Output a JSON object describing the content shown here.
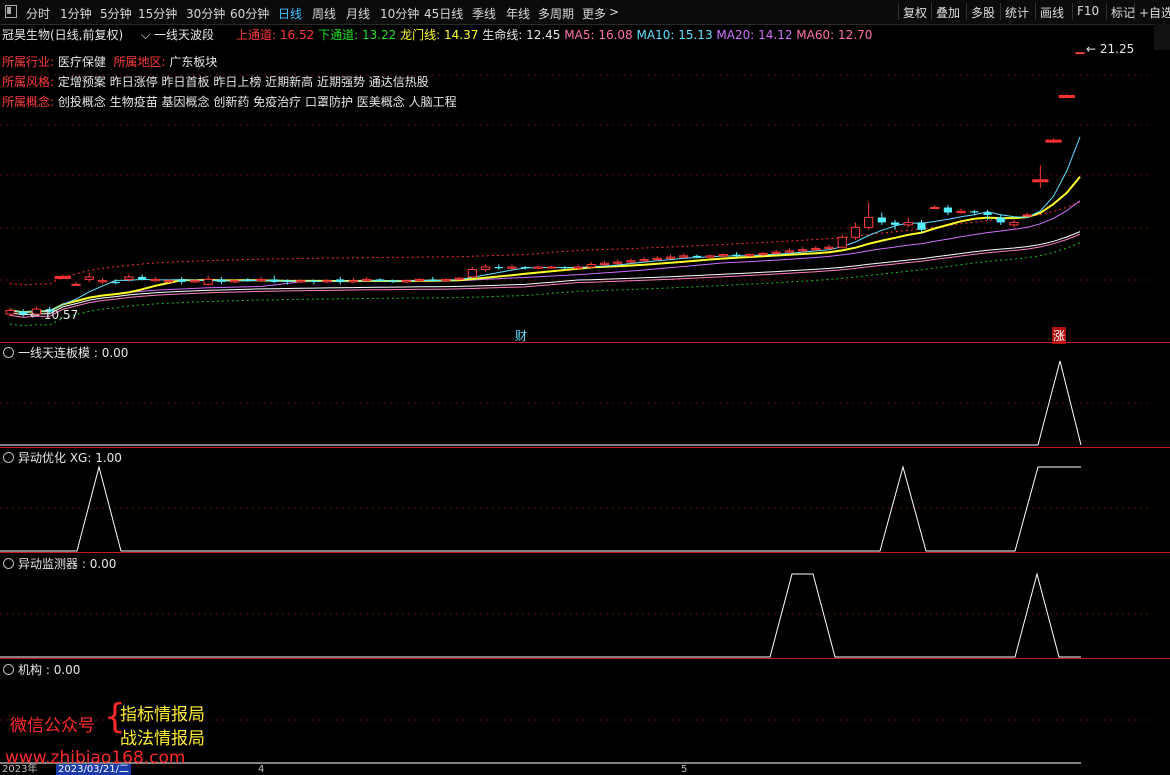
{
  "toolbar": {
    "periods": [
      "分时",
      "1分钟",
      "5分钟",
      "15分钟",
      "30分钟",
      "60分钟",
      "日线",
      "周线",
      "月线",
      "10分钟",
      "45日线",
      "季线",
      "年线",
      "多周期",
      "更多"
    ],
    "active_period": "日线",
    "right_buttons": [
      "复权",
      "叠加",
      "多股",
      "统计",
      "画线",
      "F10",
      "标记",
      "+自选"
    ]
  },
  "header": {
    "stock_title": "冠昊生物(日线,前复权)",
    "indicator_name": "一线天波段",
    "upper_label": "上通道:",
    "upper_value": "16.52",
    "lower_label": "下通道:",
    "lower_value": "13.22",
    "dragon_label": "龙门线:",
    "dragon_value": "14.37",
    "life_label": "生命线:",
    "life_value": "12.45",
    "ma5_label": "MA5:",
    "ma5_value": "16.08",
    "ma10_label": "MA10:",
    "ma10_value": "15.13",
    "ma20_label": "MA20:",
    "ma20_value": "14.12",
    "ma60_label": "MA60:",
    "ma60_value": "12.70"
  },
  "info": {
    "industry_label": "所属行业:",
    "industry_value": "医疗保健",
    "region_label": "所属地区:",
    "region_value": "广东板块",
    "style_label": "所属风格:",
    "style_value": "定增预案 昨日涨停 昨日首板 昨日上榜 近期新高 近期强势 通达信热股",
    "concept_label": "所属概念:",
    "concept_value": "创投概念 生物疫苗 基因概念 创新药 免疫治疗 口罩防护 医美概念 人脑工程"
  },
  "price_labels": {
    "high": "21.25",
    "low": "10.57",
    "marker_cai": "财",
    "marker_zhang": "涨"
  },
  "panels": [
    {
      "name": "一线天连板模",
      "value_text": " : 0.00"
    },
    {
      "name": "异动优化",
      "value_text": " XG: 1.00"
    },
    {
      "name": "异动监测器",
      "value_text": " : 0.00"
    },
    {
      "name": "机构",
      "value_text": " : 0.00"
    }
  ],
  "watermark": {
    "wechat": "微信公众号",
    "line1": "指标情报局",
    "line2": "战法情报局",
    "url": "www.zhibiao168.com"
  },
  "date_axis": {
    "year": "2023年",
    "cursor_date": "2023/03/21/二",
    "month_4": "4",
    "month_5": "5"
  },
  "colors": {
    "up": "#ff3b3b",
    "down": "#54f0ff",
    "limit_up": "#ffee00",
    "ma5": "#ffffff",
    "ma10": "#ffff2a",
    "ma20": "#d070ff",
    "ma60": "#22e022"
  },
  "chart_data": {
    "type": "candlestick",
    "price_axis_range": [
      10.3,
      21.6
    ],
    "candles": [
      [
        10.7,
        10.85,
        10.95,
        10.6
      ],
      [
        10.8,
        10.7,
        10.9,
        10.6
      ],
      [
        10.7,
        10.9,
        11.0,
        10.65
      ],
      [
        10.9,
        10.8,
        11.0,
        10.7
      ],
      [
        12.2,
        12.2,
        12.3,
        12.15
      ],
      [
        11.9,
        11.9,
        12.0,
        11.85
      ],
      [
        12.1,
        12.2,
        12.35,
        12.0
      ],
      [
        12.0,
        12.05,
        12.15,
        11.9
      ],
      [
        12.0,
        11.95,
        12.1,
        11.9
      ],
      [
        12.1,
        12.2,
        12.3,
        12.0
      ],
      [
        12.2,
        12.1,
        12.3,
        12.05
      ],
      [
        12.05,
        12.1,
        12.2,
        12.0
      ],
      [
        12.0,
        12.05,
        12.1,
        11.95
      ],
      [
        12.1,
        12.0,
        12.2,
        11.9
      ],
      [
        12.0,
        12.05,
        12.1,
        11.95
      ],
      [
        11.9,
        12.1,
        12.25,
        11.85
      ],
      [
        12.1,
        12.0,
        12.2,
        11.9
      ],
      [
        12.0,
        12.05,
        12.1,
        11.95
      ],
      [
        12.1,
        12.05,
        12.15,
        12.0
      ],
      [
        12.05,
        12.1,
        12.2,
        12.0
      ],
      [
        12.1,
        12.0,
        12.25,
        11.95
      ],
      [
        12.05,
        12.0,
        12.1,
        11.9
      ],
      [
        12.0,
        12.05,
        12.1,
        11.95
      ],
      [
        12.05,
        12.0,
        12.1,
        11.9
      ],
      [
        12.0,
        12.05,
        12.1,
        11.95
      ],
      [
        12.1,
        12.0,
        12.2,
        11.9
      ],
      [
        12.0,
        12.05,
        12.15,
        11.95
      ],
      [
        12.05,
        12.1,
        12.2,
        12.0
      ],
      [
        12.1,
        12.05,
        12.15,
        12.0
      ],
      [
        12.05,
        12.0,
        12.1,
        11.95
      ],
      [
        12.0,
        12.05,
        12.1,
        11.95
      ],
      [
        12.05,
        12.1,
        12.15,
        12.0
      ],
      [
        12.1,
        12.05,
        12.2,
        12.0
      ],
      [
        12.05,
        12.1,
        12.15,
        12.0
      ],
      [
        12.1,
        12.15,
        12.2,
        12.05
      ],
      [
        12.2,
        12.5,
        12.6,
        12.15
      ],
      [
        12.5,
        12.6,
        12.7,
        12.4
      ],
      [
        12.6,
        12.55,
        12.7,
        12.5
      ],
      [
        12.55,
        12.6,
        12.7,
        12.5
      ],
      [
        12.6,
        12.55,
        12.65,
        12.5
      ],
      [
        12.55,
        12.6,
        12.65,
        12.5
      ],
      [
        12.6,
        12.6,
        12.65,
        12.55
      ],
      [
        12.6,
        12.55,
        12.65,
        12.5
      ],
      [
        12.55,
        12.6,
        12.7,
        12.5
      ],
      [
        12.6,
        12.7,
        12.8,
        12.55
      ],
      [
        12.7,
        12.75,
        12.85,
        12.65
      ],
      [
        12.75,
        12.8,
        12.9,
        12.7
      ],
      [
        12.8,
        12.85,
        12.95,
        12.75
      ],
      [
        12.85,
        12.9,
        13.0,
        12.8
      ],
      [
        12.9,
        12.95,
        13.05,
        12.85
      ],
      [
        12.95,
        13.0,
        13.1,
        12.9
      ],
      [
        13.0,
        13.05,
        13.15,
        12.95
      ],
      [
        13.05,
        13.0,
        13.1,
        12.95
      ],
      [
        13.0,
        13.05,
        13.1,
        12.95
      ],
      [
        13.05,
        13.1,
        13.15,
        13.0
      ],
      [
        13.1,
        13.05,
        13.2,
        13.0
      ],
      [
        13.05,
        13.1,
        13.15,
        13.0
      ],
      [
        13.1,
        13.15,
        13.2,
        13.05
      ],
      [
        13.15,
        13.2,
        13.3,
        13.1
      ],
      [
        13.2,
        13.25,
        13.35,
        13.15
      ],
      [
        13.25,
        13.3,
        13.4,
        13.2
      ],
      [
        13.3,
        13.35,
        13.45,
        13.25
      ],
      [
        13.35,
        13.4,
        13.5,
        13.3
      ],
      [
        13.4,
        13.8,
        13.9,
        13.35
      ],
      [
        13.8,
        14.2,
        14.4,
        13.7
      ],
      [
        14.2,
        14.6,
        15.2,
        14.1
      ],
      [
        14.6,
        14.4,
        14.8,
        14.3
      ],
      [
        14.4,
        14.3,
        14.5,
        14.1
      ],
      [
        14.3,
        14.4,
        14.6,
        14.2
      ],
      [
        14.4,
        14.1,
        14.5,
        14.0
      ],
      [
        15.0,
        15.0,
        15.1,
        14.95
      ],
      [
        15.0,
        14.8,
        15.1,
        14.7
      ],
      [
        14.8,
        14.85,
        14.95,
        14.75
      ],
      [
        14.85,
        14.8,
        14.9,
        14.7
      ],
      [
        14.8,
        14.7,
        14.9,
        14.5
      ],
      [
        14.6,
        14.4,
        14.7,
        14.3
      ],
      [
        14.3,
        14.4,
        14.5,
        14.2
      ],
      [
        14.7,
        14.7,
        14.8,
        14.6
      ],
      [
        16.1,
        16.1,
        16.7,
        15.8
      ],
      [
        17.7,
        17.7,
        17.8,
        17.6
      ],
      [
        19.5,
        19.5,
        19.6,
        19.4
      ],
      [
        21.25,
        21.25,
        21.25,
        21.25
      ]
    ],
    "bottom_panels": [
      "一线天连板模",
      "异动优化",
      "异动监测器",
      "机构"
    ]
  }
}
